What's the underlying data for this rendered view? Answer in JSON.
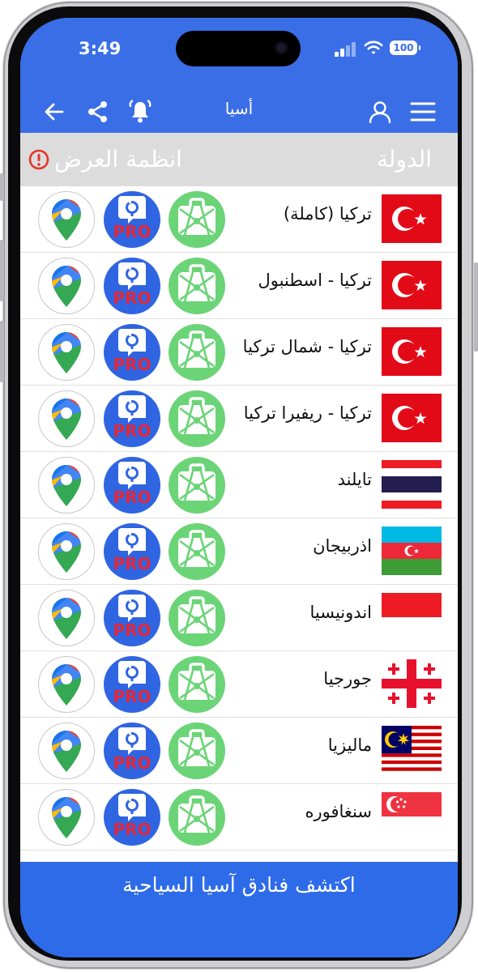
{
  "status": {
    "time": "3:49",
    "battery": "100"
  },
  "nav": {
    "title": "أسيا"
  },
  "header": {
    "country": "الدولة",
    "systems": "انظمة العرض"
  },
  "rows": [
    {
      "name": "تركيا (كاملة)",
      "flag": "turkey"
    },
    {
      "name": "تركيا - اسطنبول",
      "flag": "turkey"
    },
    {
      "name": "تركيا - شمال تركيا",
      "flag": "turkey"
    },
    {
      "name": "تركيا - ريفيرا تركيا",
      "flag": "turkey"
    },
    {
      "name": "تايلند",
      "flag": "thailand"
    },
    {
      "name": "اذربيجان",
      "flag": "azerbaijan"
    },
    {
      "name": "اندونيسيا",
      "flag": "indonesia"
    },
    {
      "name": "جورجيا",
      "flag": "georgia"
    },
    {
      "name": "ماليزيا",
      "flag": "malaysia"
    },
    {
      "name": "سنغافوره",
      "flag": "singapore"
    }
  ],
  "pro_badge": "PRO",
  "bottom": {
    "label": "اكتشف فنادق آسيا السياحية"
  },
  "colors": {
    "primary": "#3a6ee6",
    "header_bg": "#dcdcdc",
    "suitcase_green": "#6bd477",
    "pro_blue": "#3065e2",
    "pro_red": "#e32636",
    "warning": "#e5352b"
  }
}
